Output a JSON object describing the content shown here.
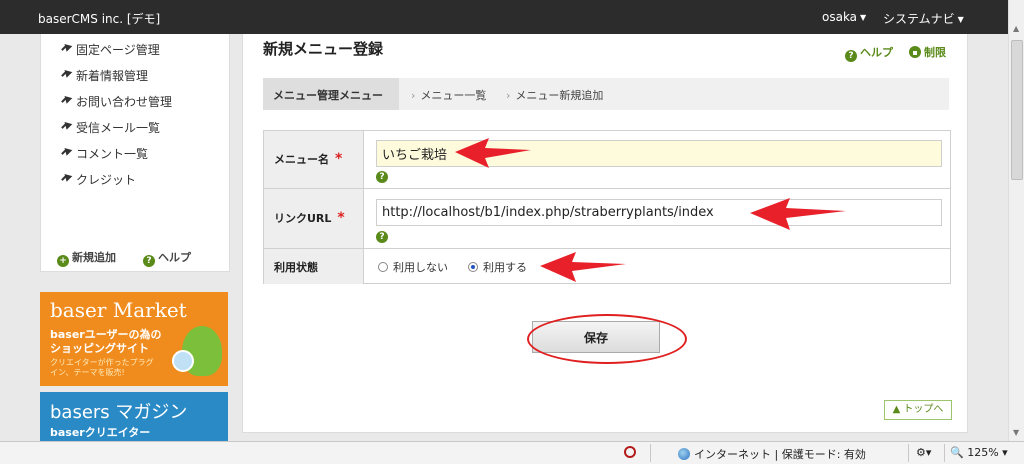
{
  "topbar": {
    "site_name": "baserCMS inc. [デモ]",
    "user": "osaka",
    "system_nav": "システムナビ"
  },
  "sidebar": {
    "items": [
      {
        "label": "固定ページ管理"
      },
      {
        "label": "新着情報管理"
      },
      {
        "label": "お問い合わせ管理"
      },
      {
        "label": "受信メール一覧"
      },
      {
        "label": "コメント一覧"
      },
      {
        "label": "クレジット"
      }
    ],
    "add_label": "新規追加",
    "help_label": "ヘルプ"
  },
  "banners": {
    "market": {
      "title": "baser Market",
      "line1": "baserユーザーの為の",
      "line2": "ショッピングサイト",
      "sub": "クリエイターが作ったプラグイン、テーマを販売!"
    },
    "magazine": {
      "title": "basers マガジン",
      "line1": "baserクリエイター"
    }
  },
  "main": {
    "title": "新規メニュー登録",
    "help_label": "ヘルプ",
    "restrict_label": "制限",
    "menubar": {
      "title": "メニュー管理メニュー",
      "items": [
        {
          "label": "メニュー一覧"
        },
        {
          "label": "メニュー新規追加"
        }
      ]
    },
    "form": {
      "name_label": "メニュー名",
      "name_value": "いちご栽培",
      "url_label": "リンクURL",
      "url_value": "http://localhost/b1/index.php/straberryplants/index",
      "status_label": "利用状態",
      "status_options": [
        {
          "label": "利用しない",
          "checked": false
        },
        {
          "label": "利用する",
          "checked": true
        }
      ],
      "required_mark": "*",
      "help_mark": "?"
    },
    "save_label": "保存",
    "to_top_label": "▲ トップへ"
  },
  "statusbar": {
    "zone": "インターネット | 保護モード: 有効",
    "zoom": "125%"
  },
  "colors": {
    "accent_green": "#5a8a1a",
    "annotation_red": "#e02020",
    "topbar_bg": "#2c2c2c"
  }
}
